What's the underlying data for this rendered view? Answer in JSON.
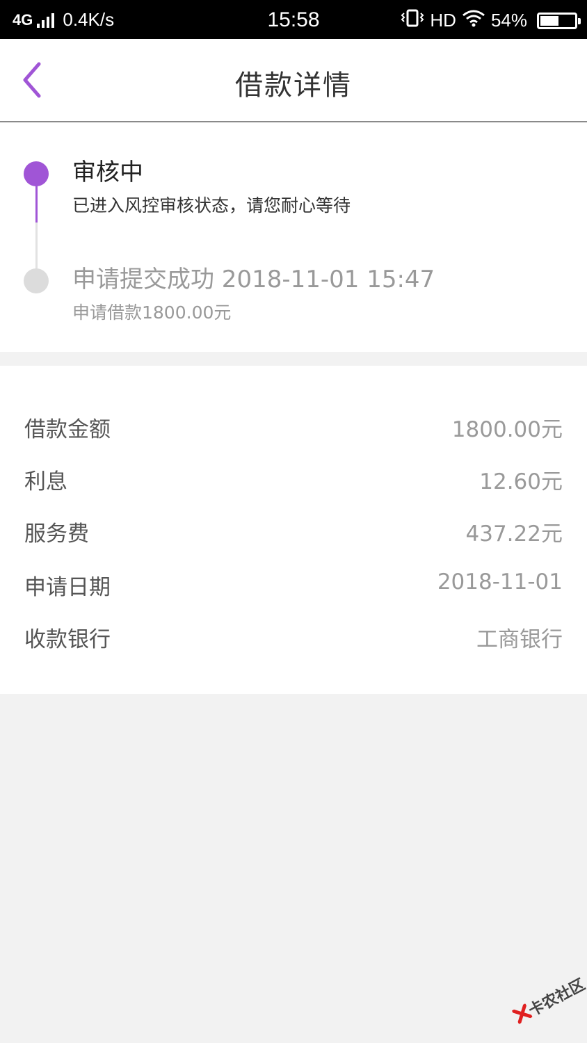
{
  "status_bar": {
    "network": "4G",
    "speed": "0.4K/s",
    "time": "15:58",
    "hd": "HD",
    "battery_text": "54%",
    "battery_level": 0.54
  },
  "nav": {
    "title": "借款详情",
    "accent_color": "#a055d6"
  },
  "timeline": {
    "steps": [
      {
        "title": "审核中",
        "desc": "已进入风控审核状态，请您耐心等待",
        "active": true
      },
      {
        "title": "申请提交成功 2018-11-01 15:47",
        "desc": "申请借款1800.00元",
        "active": false
      }
    ]
  },
  "details": {
    "rows": [
      {
        "label": "借款金额",
        "value": "1800.00元"
      },
      {
        "label": "利息",
        "value": "12.60元"
      },
      {
        "label": "服务费",
        "value": "437.22元"
      },
      {
        "label": "申请日期",
        "value": "2018-11-01"
      },
      {
        "label": "收款银行",
        "value": "工商银行"
      }
    ]
  },
  "watermark": {
    "text": "卡农社区"
  }
}
